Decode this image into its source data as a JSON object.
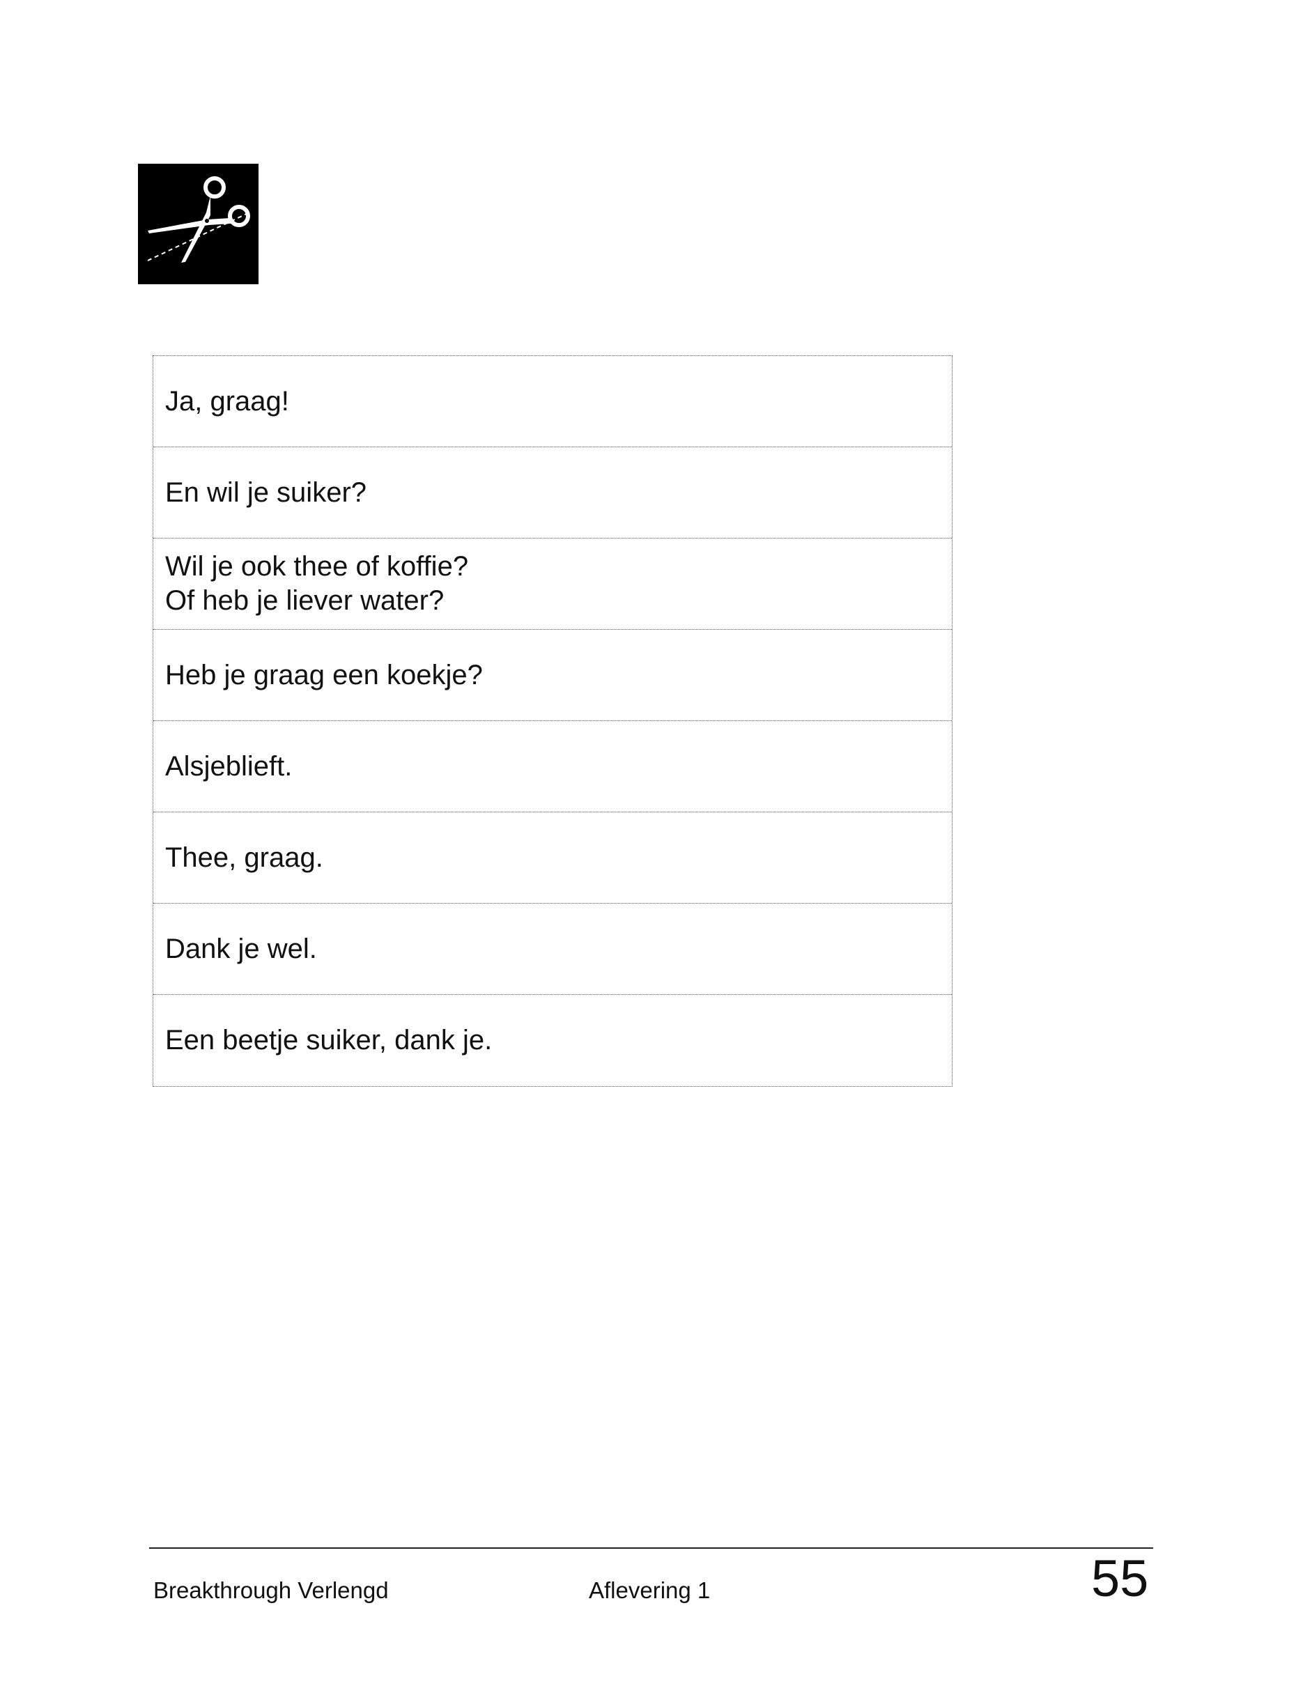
{
  "icon": {
    "name": "scissors-icon",
    "background": "#000000",
    "foreground": "#ffffff"
  },
  "cards": [
    {
      "lines": [
        "Ja, graag!"
      ]
    },
    {
      "lines": [
        "En wil je suiker?"
      ]
    },
    {
      "lines": [
        "Wil je ook thee of koffie?",
        "Of heb je liever water?"
      ]
    },
    {
      "lines": [
        "Heb je graag een koekje?"
      ]
    },
    {
      "lines": [
        "Alsjeblieft."
      ]
    },
    {
      "lines": [
        "Thee, graag."
      ]
    },
    {
      "lines": [
        "Dank je wel."
      ]
    },
    {
      "lines": [
        "Een beetje suiker, dank je."
      ]
    }
  ],
  "footer": {
    "left": "Breakthrough Verlengd",
    "center": "Aflevering 1",
    "page_number": "55"
  }
}
